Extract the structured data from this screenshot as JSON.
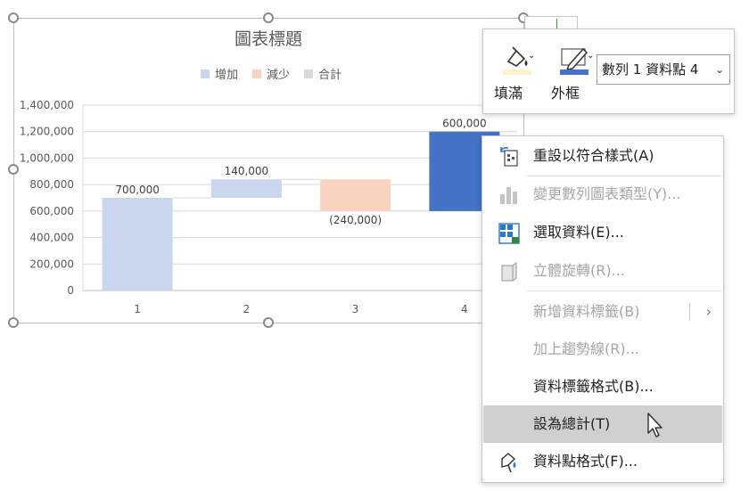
{
  "chart_data": {
    "type": "bar",
    "subtype": "waterfall",
    "title": "圖表標題",
    "legend": {
      "placement": "top",
      "entries": [
        {
          "name": "增加",
          "color": "#c9d6ee"
        },
        {
          "name": "減少",
          "color": "#f8d4c0"
        },
        {
          "name": "合計",
          "color": "#d9d9d9"
        }
      ]
    },
    "categories": [
      "1",
      "2",
      "3",
      "4"
    ],
    "values": [
      700000,
      140000,
      -240000,
      600000
    ],
    "bars": [
      {
        "category": "1",
        "start": 0,
        "end": 700000,
        "kind": "increase",
        "label": "700,000",
        "color": "#c9d6ee"
      },
      {
        "category": "2",
        "start": 700000,
        "end": 840000,
        "kind": "increase",
        "label": "140,000",
        "color": "#c9d6ee"
      },
      {
        "category": "3",
        "start": 840000,
        "end": 600000,
        "kind": "decrease",
        "label": "(240,000)",
        "color": "#f8d4c0"
      },
      {
        "category": "4",
        "start": 600000,
        "end": 1200000,
        "kind": "increase",
        "label": "600,000",
        "color": "#4472c4",
        "selected": true
      }
    ],
    "ylim": [
      0,
      1400000
    ],
    "yticks": [
      0,
      200000,
      400000,
      600000,
      800000,
      1000000,
      1200000,
      1400000
    ],
    "ytick_labels": [
      "0",
      "200,000",
      "400,000",
      "600,000",
      "800,000",
      "1,000,000",
      "1,200,000",
      "1,400,000"
    ],
    "grid": true
  },
  "mini_toolbar": {
    "fill_label": "填滿",
    "outline_label": "外框",
    "fill_color": "#fff2cc",
    "outline_color": "#4472c4",
    "series_point_value": "數列 1 資料點 4"
  },
  "context_menu": {
    "items": [
      {
        "label": "重設以符合樣式(A)",
        "icon": "reset-style-icon",
        "enabled": true
      },
      {
        "label": "變更數列圖表類型(Y)...",
        "icon": "chart-type-icon",
        "enabled": false
      },
      {
        "label": "選取資料(E)...",
        "icon": "select-data-icon",
        "enabled": true
      },
      {
        "label": "立體旋轉(R)...",
        "icon": "rotation-3d-icon",
        "enabled": false
      },
      {
        "label": "新增資料標籤(B)",
        "icon": "",
        "enabled": false,
        "submenu": true
      },
      {
        "label": "加上趨勢線(R)...",
        "icon": "",
        "enabled": false
      },
      {
        "label": "資料標籤格式(B)...",
        "icon": "",
        "enabled": true
      },
      {
        "label": "設為總計(T)",
        "icon": "",
        "enabled": true,
        "hover": true
      },
      {
        "label": "資料點格式(F)...",
        "icon": "format-point-icon",
        "enabled": true
      }
    ]
  }
}
